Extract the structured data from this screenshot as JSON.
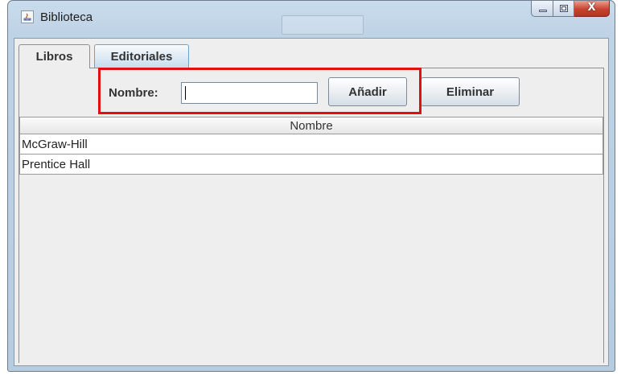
{
  "window": {
    "title": "Biblioteca",
    "icon": "java-app-icon"
  },
  "tabs": [
    {
      "label": "Libros",
      "selected": false
    },
    {
      "label": "Editoriales",
      "selected": true
    }
  ],
  "form": {
    "name_label": "Nombre:",
    "name_value": "",
    "add_button": "Añadir",
    "delete_button": "Eliminar"
  },
  "table": {
    "columns": [
      "Nombre"
    ],
    "rows": [
      [
        "McGraw-Hill"
      ],
      [
        "Prentice Hall"
      ]
    ]
  },
  "colors": {
    "highlight": "#e01010",
    "close_button": "#c6432f"
  },
  "caption_buttons": [
    "minimize-icon",
    "maximize-icon",
    "close-icon"
  ],
  "close_glyph": "X"
}
